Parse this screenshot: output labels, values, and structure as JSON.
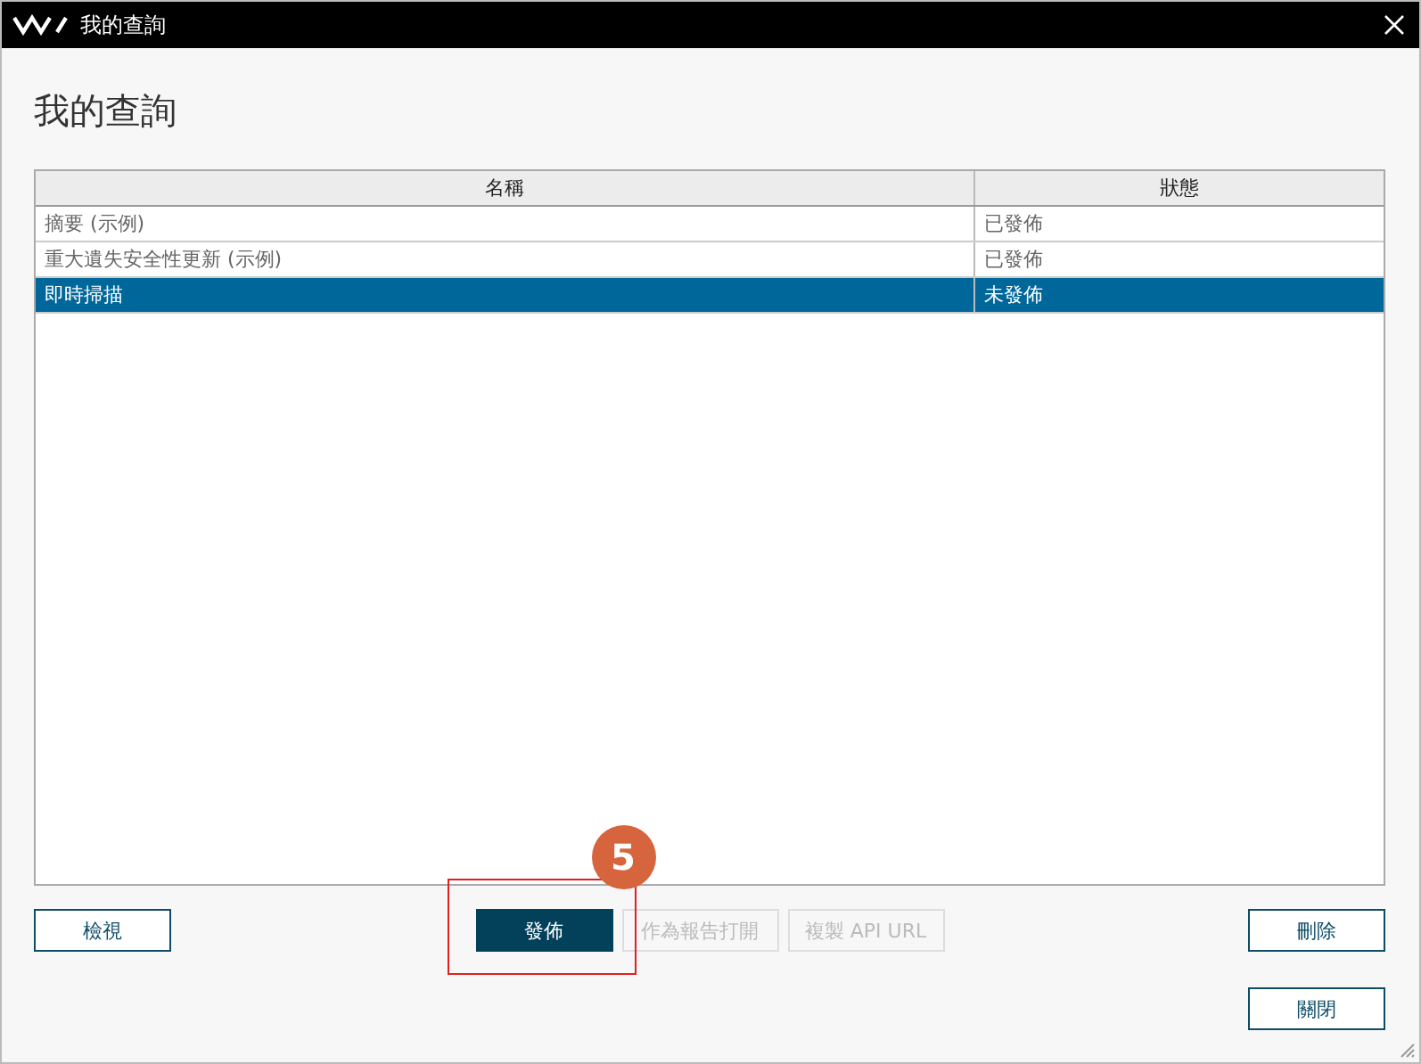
{
  "window": {
    "title": "我的查詢"
  },
  "heading": "我的查詢",
  "table": {
    "columns": [
      "名稱",
      "狀態"
    ],
    "rows": [
      {
        "name": "摘要 (示例)",
        "status": "已發佈",
        "selected": false
      },
      {
        "name": "重大遺失安全性更新 (示例)",
        "status": "已發佈",
        "selected": false
      },
      {
        "name": "即時掃描",
        "status": "未發佈",
        "selected": true
      }
    ]
  },
  "buttons_left": [
    {
      "label": "檢視",
      "kind": "outline",
      "disabled": false
    }
  ],
  "buttons_middle": [
    {
      "label": "發佈",
      "kind": "primary",
      "disabled": false
    },
    {
      "label": "作為報告打開",
      "kind": "outline",
      "disabled": true
    },
    {
      "label": "複製 API URL",
      "kind": "outline",
      "disabled": true
    }
  ],
  "buttons_right": [
    {
      "label": "刪除",
      "kind": "outline",
      "disabled": false
    }
  ],
  "footer_buttons": [
    {
      "label": "關閉",
      "kind": "outline",
      "disabled": false
    }
  ],
  "callout": {
    "step": "5"
  }
}
